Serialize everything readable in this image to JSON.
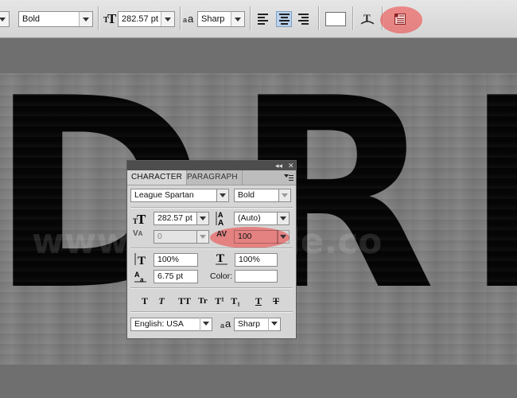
{
  "options_bar": {
    "font_style": "Bold",
    "font_size": "282.57 pt",
    "aa_label": "a",
    "aa_label2": "a",
    "antialias": "Sharp",
    "alignment": [
      "left",
      "center",
      "right"
    ],
    "active_alignment": "center",
    "text_color": "#ffffff"
  },
  "canvas": {
    "headline": "DRIP",
    "watermark": "www.psd-dude.co"
  },
  "character_panel": {
    "tabs": [
      "CHARACTER",
      "PARAGRAPH"
    ],
    "active_tab": "CHARACTER",
    "top_icons": [
      "◂◂",
      "✕"
    ],
    "font_family": "League Spartan",
    "font_style": "Bold",
    "font_size": "282.57 pt",
    "leading": "(Auto)",
    "kerning": "0",
    "tracking": "100",
    "vertical_scale": "100%",
    "horizontal_scale": "100%",
    "baseline_shift": "6.75 pt",
    "color_label": "Color:",
    "color_value": "#ffffff",
    "style_buttons": [
      "T",
      "T",
      "TT",
      "Tr",
      "T¹",
      "T₁",
      "T",
      "T"
    ],
    "language": "English: USA",
    "aa_small": "a",
    "antialias": "Sharp"
  },
  "highlights": {
    "color": "#f03c3c",
    "targets": [
      "character-panel-toggle-button",
      "tracking-field"
    ]
  }
}
